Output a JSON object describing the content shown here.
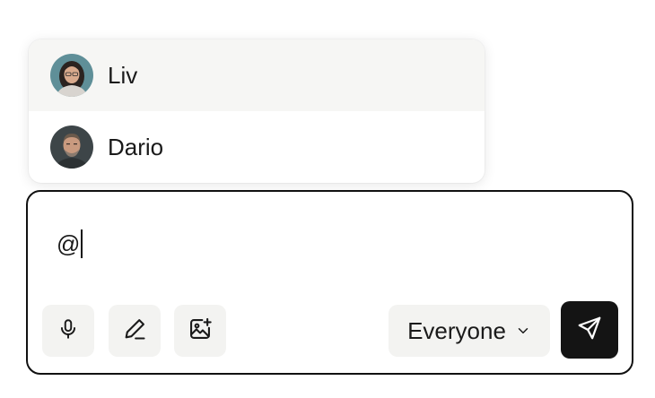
{
  "mention_menu": {
    "users": [
      {
        "name": "Liv",
        "avatar": "avatar-liv",
        "highlighted": true
      },
      {
        "name": "Dario",
        "avatar": "avatar-dario",
        "highlighted": false
      }
    ]
  },
  "composer": {
    "value": "@",
    "tools": [
      {
        "icon": "microphone-icon"
      },
      {
        "icon": "pencil-icon"
      },
      {
        "icon": "image-add-icon"
      }
    ],
    "audience": {
      "selected": "Everyone",
      "icon": "chevron-down-icon"
    },
    "send": {
      "icon": "send-icon"
    }
  },
  "colors": {
    "highlight_row": "#f6f6f4",
    "button_bg": "#f3f3f1",
    "send_bg": "#141414",
    "border": "#111111"
  }
}
